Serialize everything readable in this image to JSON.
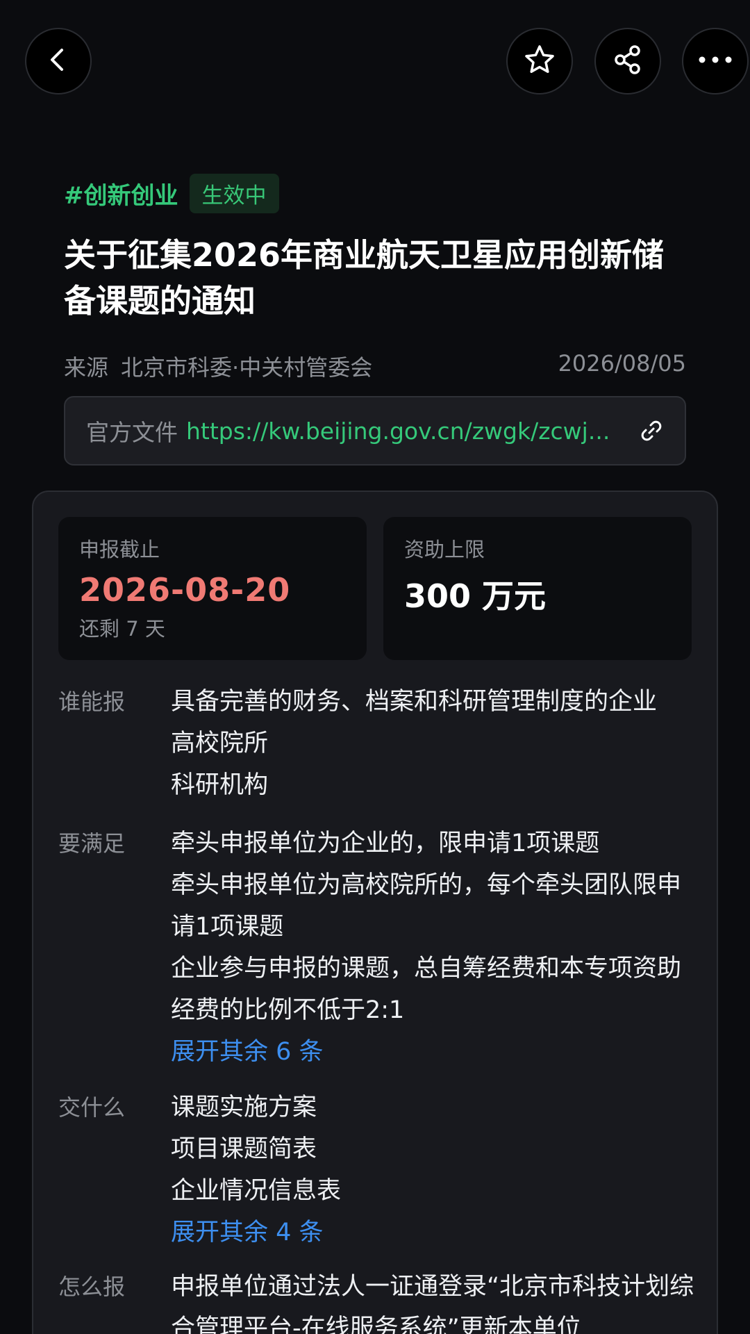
{
  "header": {
    "hashtag": "#创新创业",
    "status": "生效中",
    "title": "关于征集2026年商业航天卫星应用创新储备课题的通知",
    "source_label": "来源",
    "source_value": "北京市科委·中关村管委会",
    "date": "2026/08/05",
    "doc_label": "官方文件",
    "doc_url": "https://kw.beijing.gov.cn/zwgk/zcwj..."
  },
  "toolbar": {
    "icons": [
      "chevron-left-icon",
      "star-icon",
      "share-icon",
      "more-icon"
    ]
  },
  "stats": {
    "deadline_label": "申报截止",
    "deadline_value": "2026-08-20",
    "deadline_sub": "还剩 7 天",
    "funding_label": "资助上限",
    "funding_value": "300 万元"
  },
  "sections": {
    "who": {
      "label": "谁能报",
      "items": [
        "具备完善的财务、档案和科研管理制度的企业",
        "高校院所",
        "科研机构"
      ]
    },
    "requirements": {
      "label": "要满足",
      "items": [
        "牵头申报单位为企业的，限申请1项课题",
        "牵头申报单位为高校院所的，每个牵头团队限申请1项课题",
        "企业参与申报的课题，总自筹经费和本专项资助经费的比例不低于2:1"
      ],
      "expand": "展开其余 6 条"
    },
    "documents": {
      "label": "交什么",
      "items": [
        "课题实施方案",
        "项目课题简表",
        "企业情况信息表"
      ],
      "expand": "展开其余 4 条"
    },
    "how": {
      "label": "怎么报",
      "text": "申报单位通过法人一证通登录“北京市科技计划综合管理平台-在线服务系统”更新本单位"
    }
  },
  "colors": {
    "accent_green": "#35c97a",
    "deadline_red": "#f07a74",
    "link_blue": "#3d8ff0",
    "background": "#0b0c0f"
  }
}
